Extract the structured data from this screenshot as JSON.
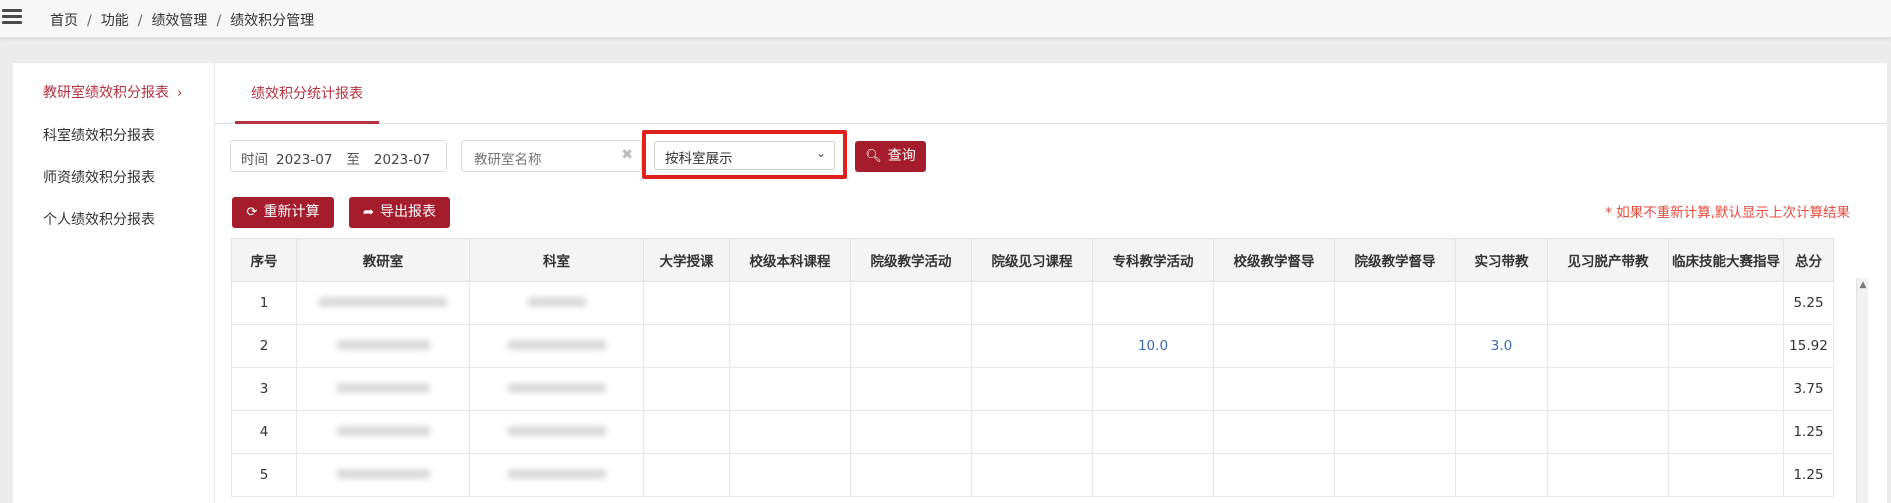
{
  "breadcrumb": {
    "items": [
      "首页",
      "功能",
      "绩效管理",
      "绩效积分管理"
    ],
    "separator": "/"
  },
  "sidebar": {
    "items": [
      {
        "label": "教研室绩效积分报表",
        "active": true
      },
      {
        "label": "科室绩效积分报表",
        "active": false
      },
      {
        "label": "师资绩效积分报表",
        "active": false
      },
      {
        "label": "个人绩效积分报表",
        "active": false
      }
    ],
    "active_chevron": "›"
  },
  "tabs": [
    {
      "label": "绩效积分统计报表",
      "active": true
    }
  ],
  "filters": {
    "time_label": "时间",
    "start": "2023-07",
    "to_label": "至",
    "end": "2023-07",
    "room_placeholder": "教研室名称",
    "clear_glyph": "✖",
    "display_mode": "按科室展示",
    "query_label": "查询"
  },
  "actions": {
    "recalc_label": "重新计算",
    "export_label": "导出报表"
  },
  "note": "* 如果不重新计算,默认显示上次计算结果",
  "colors": {
    "accent": "#a51d2d",
    "note": "#e84c3d",
    "link": "#3a6ab1",
    "highlight": "#e0221e"
  },
  "table": {
    "columns": [
      "序号",
      "教研室",
      "科室",
      "大学授课",
      "校级本科课程",
      "院级教学活动",
      "院级见习课程",
      "专科教学活动",
      "校级教学督导",
      "院级教学督导",
      "实习带教",
      "见习脱产带教",
      "临床技能大赛指导",
      "总分"
    ],
    "rows": [
      {
        "no": "1",
        "cells": [
          "",
          "",
          "",
          "",
          "",
          "",
          "",
          "",
          "",
          "",
          ""
        ],
        "total": "5.25"
      },
      {
        "no": "2",
        "cells": [
          "",
          "",
          "",
          "",
          "10.0",
          "",
          "",
          "3.0",
          "",
          ""
        ],
        "total": "15.92"
      },
      {
        "no": "3",
        "cells": [
          "",
          "",
          "",
          "",
          "",
          "",
          "",
          "",
          "",
          ""
        ],
        "total": "3.75"
      },
      {
        "no": "4",
        "cells": [
          "",
          "",
          "",
          "",
          "",
          "",
          "",
          "",
          "",
          ""
        ],
        "total": "1.25"
      },
      {
        "no": "5",
        "cells": [
          "",
          "",
          "",
          "",
          "",
          "",
          "",
          "",
          "",
          ""
        ],
        "total": "1.25"
      }
    ]
  },
  "icons": {
    "menu": "menu-icon",
    "search": "search-icon",
    "refresh": "refresh-icon",
    "share": "share-icon",
    "chevron": "chevron-down-icon"
  }
}
